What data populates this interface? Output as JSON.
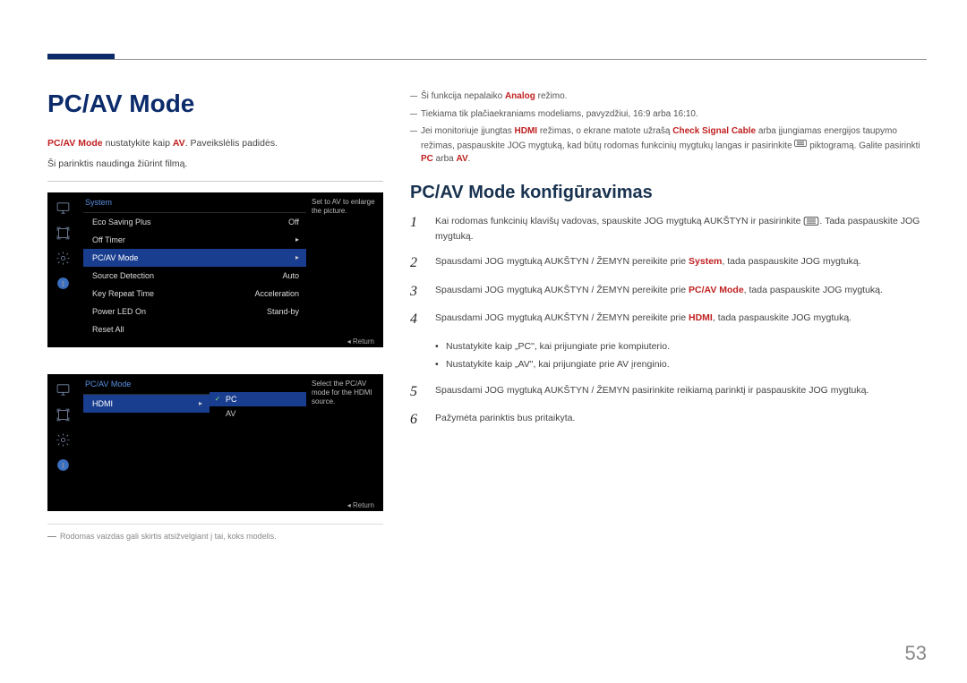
{
  "page": {
    "title": "PC/AV Mode",
    "subhead": "PC/AV Mode konfigūravimas",
    "number": "53"
  },
  "intro": {
    "line1_prefix": "PC/AV Mode",
    "line1_mid": " nustatykite kaip ",
    "line1_em": "AV",
    "line1_suffix": ". Paveikslėlis padidės.",
    "line2": "Ši parinktis naudinga žiūrint filmą."
  },
  "osd1": {
    "header": "System",
    "hint": "Set to AV to enlarge the picture.",
    "return": "Return",
    "rows": [
      {
        "label": "Eco Saving Plus",
        "value": "Off",
        "selected": false,
        "arrow": false
      },
      {
        "label": "Off Timer",
        "value": "",
        "selected": false,
        "arrow": true
      },
      {
        "label": "PC/AV Mode",
        "value": "",
        "selected": true,
        "arrow": true
      },
      {
        "label": "Source Detection",
        "value": "Auto",
        "selected": false,
        "arrow": false
      },
      {
        "label": "Key Repeat Time",
        "value": "Acceleration",
        "selected": false,
        "arrow": false
      },
      {
        "label": "Power LED On",
        "value": "Stand-by",
        "selected": false,
        "arrow": false
      },
      {
        "label": "Reset All",
        "value": "",
        "selected": false,
        "arrow": false
      }
    ]
  },
  "osd2": {
    "header": "PC/AV Mode",
    "hint": "Select the PC/AV mode for the HDMI source.",
    "return": "Return",
    "row": {
      "label": "HDMI"
    },
    "options": [
      {
        "label": "PC",
        "selected": true,
        "checked": true
      },
      {
        "label": "AV",
        "selected": false,
        "checked": false
      }
    ]
  },
  "footnote": "Rodomas vaizdas gali skirtis atsižvelgiant į tai, koks modelis.",
  "notes": {
    "n1_a": "Ši funkcija nepalaiko ",
    "n1_em": "Analog",
    "n1_b": " režimo.",
    "n2": "Tiekiama tik plačiaekraniams modeliams, pavyzdžiui, 16:9 arba 16:10.",
    "n3_a": "Jei monitoriuje įjungtas ",
    "n3_em1": "HDMI",
    "n3_b": " režimas, o ekrane matote užrašą ",
    "n3_em2": "Check Signal Cable",
    "n3_c": " arba įjungiamas energijos taupymo režimas, paspauskite JOG mygtuką, kad būtų rodomas funkcinių mygtukų langas ir pasirinkite ",
    "n3_d": " piktogramą. Galite pasirinkti ",
    "n3_em3": "PC",
    "n3_e": " arba ",
    "n3_em4": "AV",
    "n3_f": "."
  },
  "steps": {
    "s1_a": "Kai rodomas funkcinių klavišų vadovas, spauskite JOG mygtuką AUKŠTYN ir pasirinkite ",
    "s1_b": ". Tada paspauskite JOG mygtuką.",
    "s2_a": "Spausdami JOG mygtuką AUKŠTYN / ŽEMYN pereikite prie ",
    "s2_em": "System",
    "s2_b": ", tada paspauskite JOG mygtuką.",
    "s3_a": "Spausdami JOG mygtuką AUKŠTYN / ŽEMYN pereikite prie ",
    "s3_em": "PC/AV Mode",
    "s3_b": ", tada paspauskite JOG mygtuką.",
    "s4_a": "Spausdami JOG mygtuką AUKŠTYN / ŽEMYN pereikite prie ",
    "s4_em": "HDMI",
    "s4_b": ", tada paspauskite JOG mygtuką.",
    "b1": "Nustatykite kaip „PC\", kai prijungiate prie kompiuterio.",
    "b2": "Nustatykite kaip „AV\", kai prijungiate prie AV įrenginio.",
    "s5": "Spausdami JOG mygtuką AUKŠTYN / ŽEMYN pasirinkite reikiamą parinktį ir paspauskite JOG mygtuką.",
    "s6": "Pažymėta parinktis bus pritaikyta."
  }
}
